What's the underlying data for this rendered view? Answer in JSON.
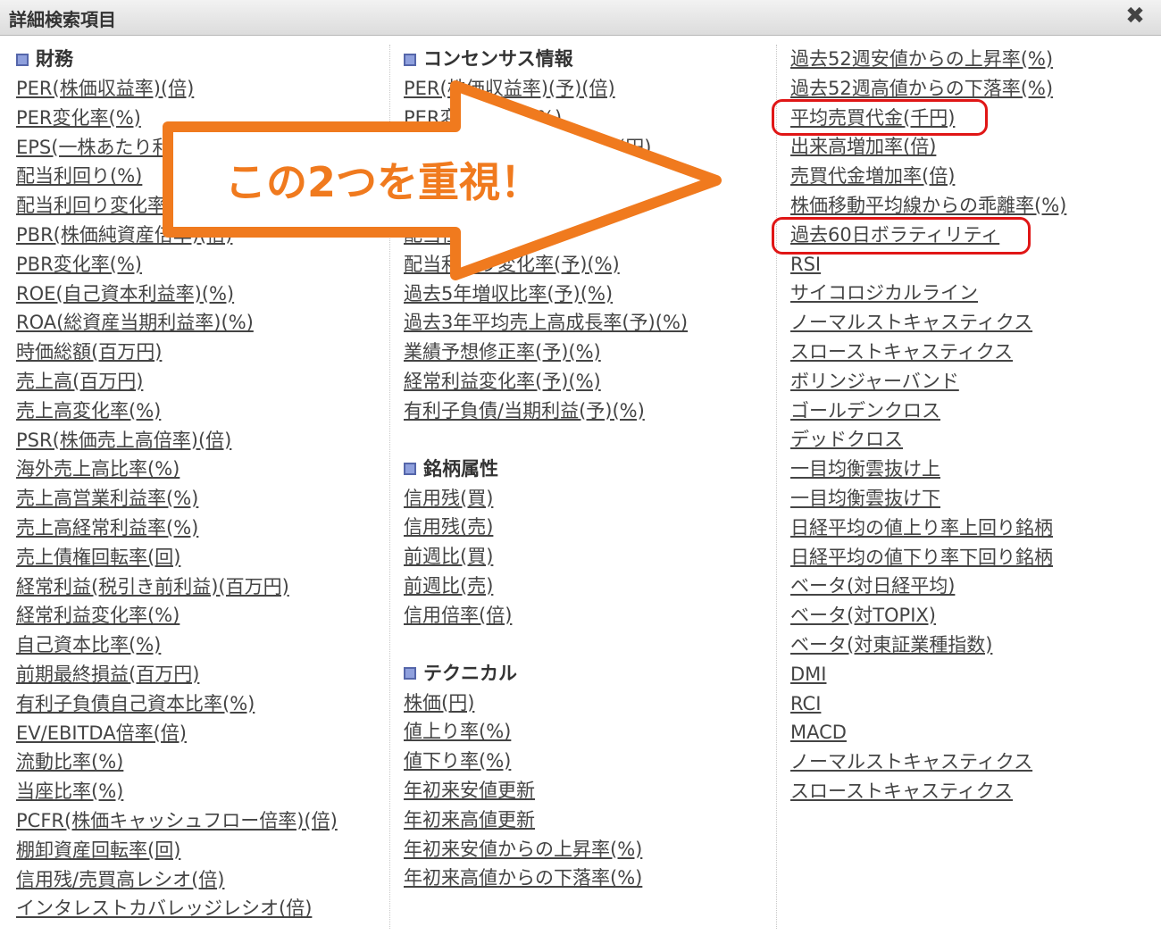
{
  "window": {
    "title": "詳細検索項目",
    "close_icon": "close-icon"
  },
  "columns": {
    "left": {
      "sections": [
        {
          "title": "財務",
          "items": [
            "PER(株価収益率)(倍)",
            "PER変化率(%)",
            "EPS(一株あたり利益)(円)",
            "配当利回り(%)",
            "配当利回り変化率(%)",
            "PBR(株価純資産倍率)(倍)",
            "PBR変化率(%)",
            "ROE(自己資本利益率)(%)",
            "ROA(総資産当期利益率)(%)",
            "時価総額(百万円)",
            "売上高(百万円)",
            "売上高変化率(%)",
            "PSR(株価売上高倍率)(倍)",
            "海外売上高比率(%)",
            "売上高営業利益率(%)",
            "売上高経常利益率(%)",
            "売上債権回転率(回)",
            "経常利益(税引き前利益)(百万円)",
            "経常利益変化率(%)",
            "自己資本比率(%)",
            "前期最終損益(百万円)",
            "有利子負債自己資本比率(%)",
            "EV/EBITDA倍率(倍)",
            "流動比率(%)",
            "当座比率(%)",
            "PCFR(株価キャッシュフロー倍率)(倍)",
            "棚卸資産回転率(回)",
            "信用残/売買高レシオ(倍)",
            "インタレストカバレッジレシオ(倍)"
          ]
        }
      ]
    },
    "middle": {
      "sections": [
        {
          "title": "コンセンサス情報",
          "items": [
            "PER(株価収益率)(予)(倍)",
            "PER変化率(予)(%)",
            "EPS(一株あたり利益)(予)(円)",
            "配当利回り(予)(%)",
            "一株あたり配当(予)(円)",
            "配当性向(予)(%)",
            "配当利回り変化率(予)(%)",
            "過去5年増収比率(予)(%)",
            "過去3年平均売上高成長率(予)(%)",
            "業績予想修正率(予)(%)",
            "経常利益変化率(予)(%)",
            "有利子負債/当期利益(予)(%)"
          ]
        },
        {
          "title": "銘柄属性",
          "items": [
            "信用残(買)",
            "信用残(売)",
            "前週比(買)",
            "前週比(売)",
            "信用倍率(倍)"
          ]
        },
        {
          "title": "テクニカル",
          "items": [
            "株価(円)",
            "値上り率(%)",
            "値下り率(%)",
            "年初来安値更新",
            "年初来高値更新",
            "年初来安値からの上昇率(%)",
            "年初来高値からの下落率(%)"
          ]
        }
      ]
    },
    "right": {
      "items": [
        "過去52週安値からの上昇率(%)",
        "過去52週高値からの下落率(%)",
        "平均売買代金(千円)",
        "出来高増加率(倍)",
        "売買代金増加率(倍)",
        "株価移動平均線からの乖離率(%)",
        "過去60日ボラティリティ",
        "RSI",
        "サイコロジカルライン",
        "ノーマルストキャスティクス",
        "スローストキャスティクス",
        "ボリンジャーバンド",
        "ゴールデンクロス",
        "デッドクロス",
        "一目均衡雲抜け上",
        "一目均衡雲抜け下",
        "日経平均の値上り率上回り銘柄",
        "日経平均の値下り率下回り銘柄",
        "ベータ(対日経平均)",
        "ベータ(対TOPIX)",
        "ベータ(対東証業種指数)",
        "DMI",
        "RCI",
        "MACD",
        "ノーマルストキャスティクス",
        "スローストキャスティクス"
      ]
    }
  },
  "annotation": {
    "arrow_text": "この2つを重視！",
    "arrow_color": "#f07a1e",
    "highlight_color": "#e01616",
    "highlighted_items": [
      "平均売買代金(千円)",
      "過去60日ボラティリティ"
    ]
  },
  "colors": {
    "link": "#444444",
    "section_icon": "#8fa0dd"
  }
}
